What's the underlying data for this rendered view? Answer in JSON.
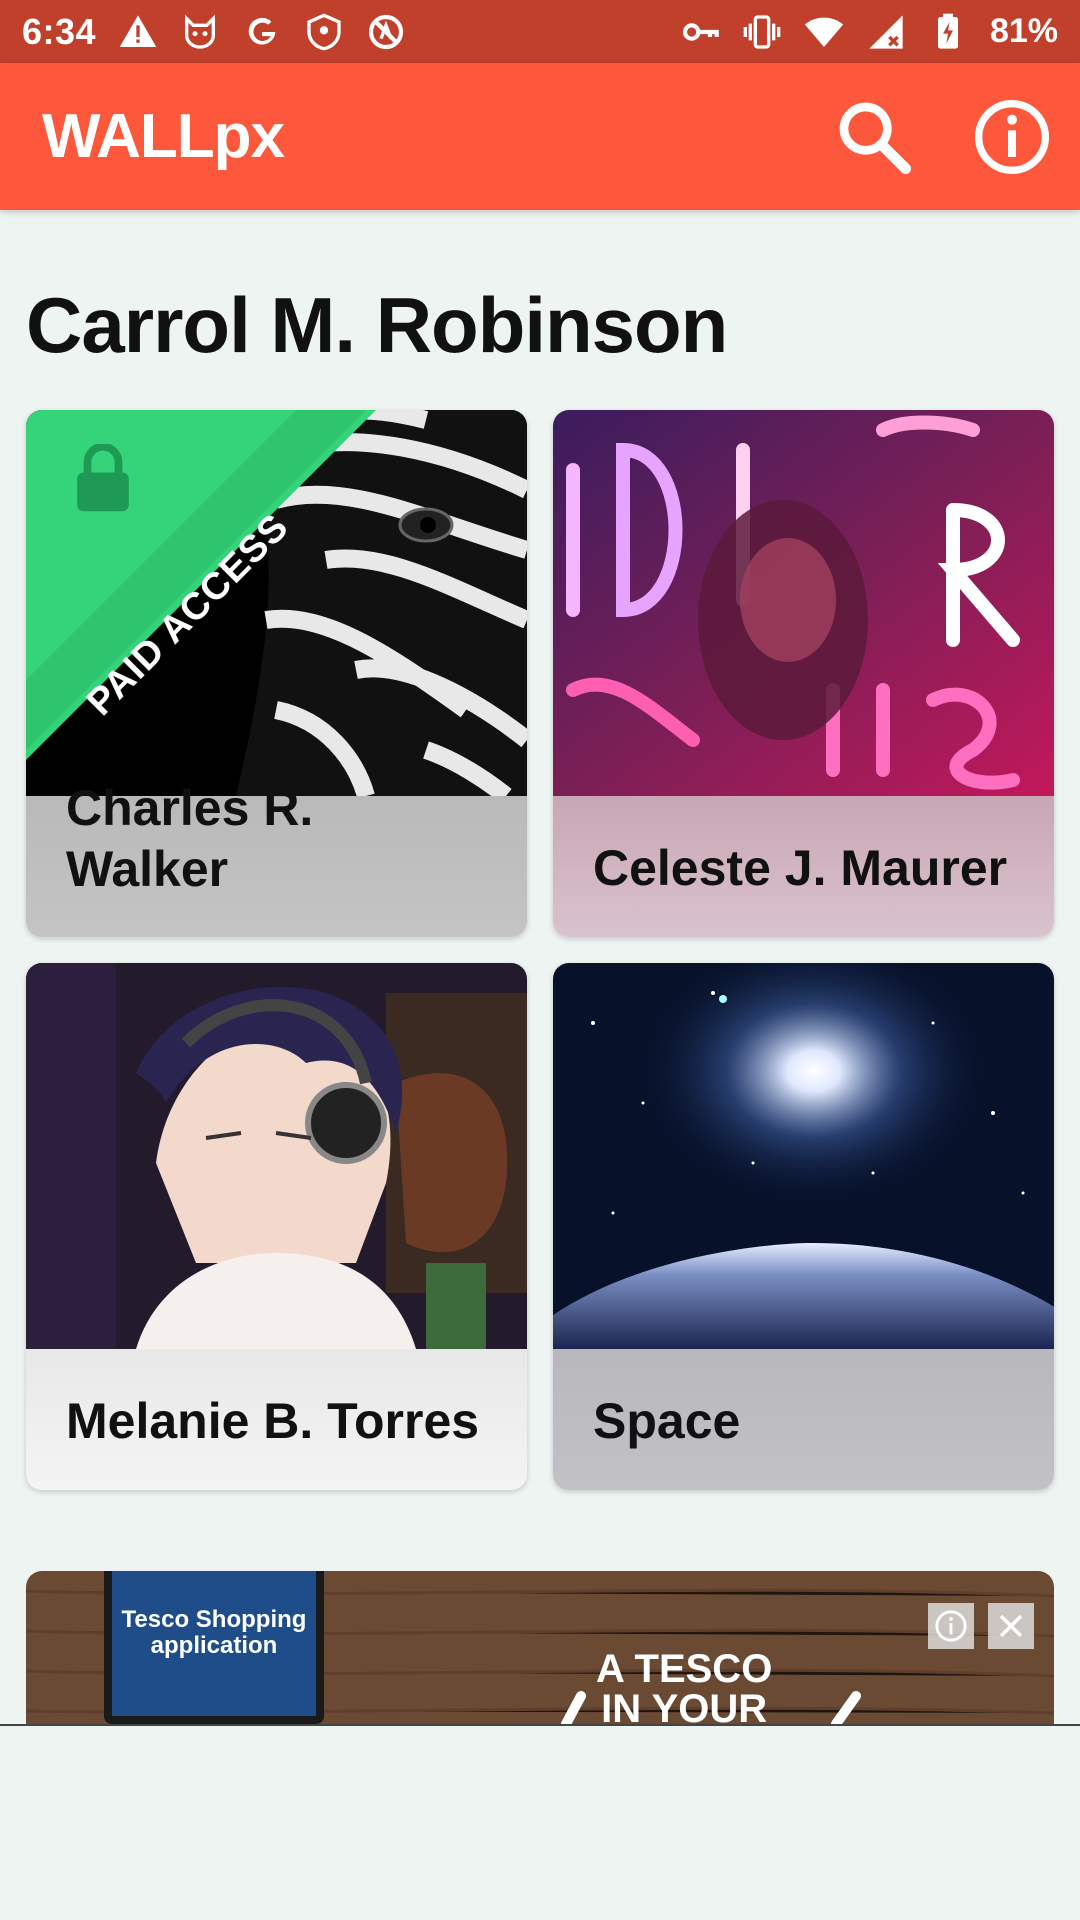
{
  "status_bar": {
    "time": "6:34",
    "battery": "81%",
    "left_icons": [
      "warning-icon",
      "cat-icon",
      "google-icon",
      "shield-icon",
      "no-sign-icon"
    ],
    "right_icons": [
      "key-icon",
      "vibrate-icon",
      "wifi-icon",
      "signal-icon",
      "battery-icon"
    ]
  },
  "app_bar": {
    "title": "WALLpx",
    "actions": [
      "search-icon",
      "info-icon"
    ]
  },
  "page": {
    "heading": "Carrol M. Robinson"
  },
  "cards": [
    {
      "label": "Charles R.\nWalker",
      "badge": "PAID ACCESS",
      "locked": true
    },
    {
      "label": "Celeste J. Maurer"
    },
    {
      "label": "Melanie B. Torres"
    },
    {
      "label": "Space"
    }
  ],
  "ad": {
    "phone_text": "Tesco Shopping application",
    "headline": "A TESCO\nIN YOUR"
  },
  "colors": {
    "status_bar": "#c0402c",
    "app_bar": "#fd583c",
    "ribbon": "#2ecc71",
    "background": "#eef4f2"
  }
}
